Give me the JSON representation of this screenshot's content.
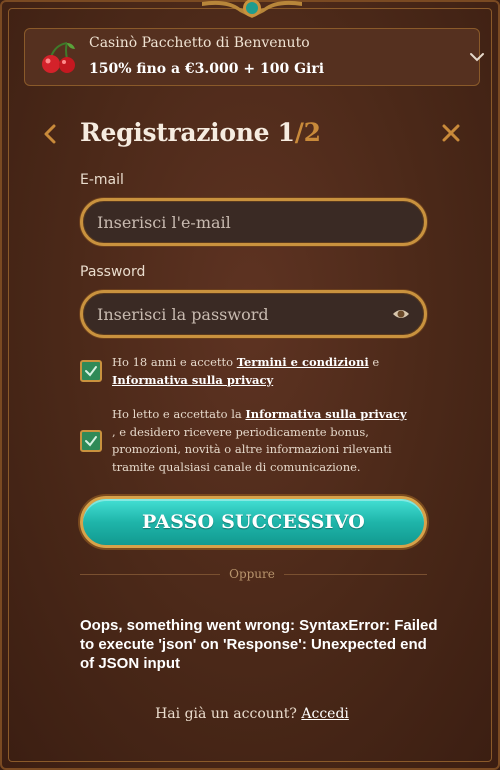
{
  "bonus": {
    "title": "Casinò Pacchetto di Benvenuto",
    "offer": "150% fino a €3.000 + 100 Giri"
  },
  "header": {
    "title": "Registrazione",
    "step_current": "1",
    "step_separator": "/",
    "step_total": "2"
  },
  "form": {
    "email_label": "E-mail",
    "email_placeholder": "Inserisci l'e-mail",
    "email_value": "",
    "password_label": "Password",
    "password_placeholder": "Inserisci la password",
    "password_value": ""
  },
  "consents": [
    {
      "checked": true,
      "prefix": "Ho 18 anni e accetto ",
      "link1": "Termini e condizioni",
      "middle": " e ",
      "link2": "Informativa sulla privacy"
    },
    {
      "checked": true,
      "prefix": "Ho letto e accettato la ",
      "link1": "Informativa sulla privacy",
      "suffix": " , e desidero ricevere periodicamente bonus, promozioni, novità o altre informazioni rilevanti tramite qualsiasi canale di comunicazione."
    }
  ],
  "cta_label": "PASSO SUCCESSIVO",
  "divider_text": "Oppure",
  "error_message": "Oops, something went wrong: SyntaxError: Failed to execute 'json' on 'Response': Unexpected end of JSON input",
  "login": {
    "prompt": "Hai già un account?",
    "link": "Accedi"
  },
  "icons": {
    "bonus": "cherry-icon",
    "expand": "chevron-down-icon",
    "back": "chevron-left-icon",
    "close": "close-icon",
    "password_toggle": "eye-icon",
    "checkbox": "checkmark-icon"
  },
  "colors": {
    "background": "#4a2818",
    "accent_gold": "#c9923e",
    "cta_teal": "#1fb5aa",
    "checkbox_green": "#2f8a58"
  }
}
